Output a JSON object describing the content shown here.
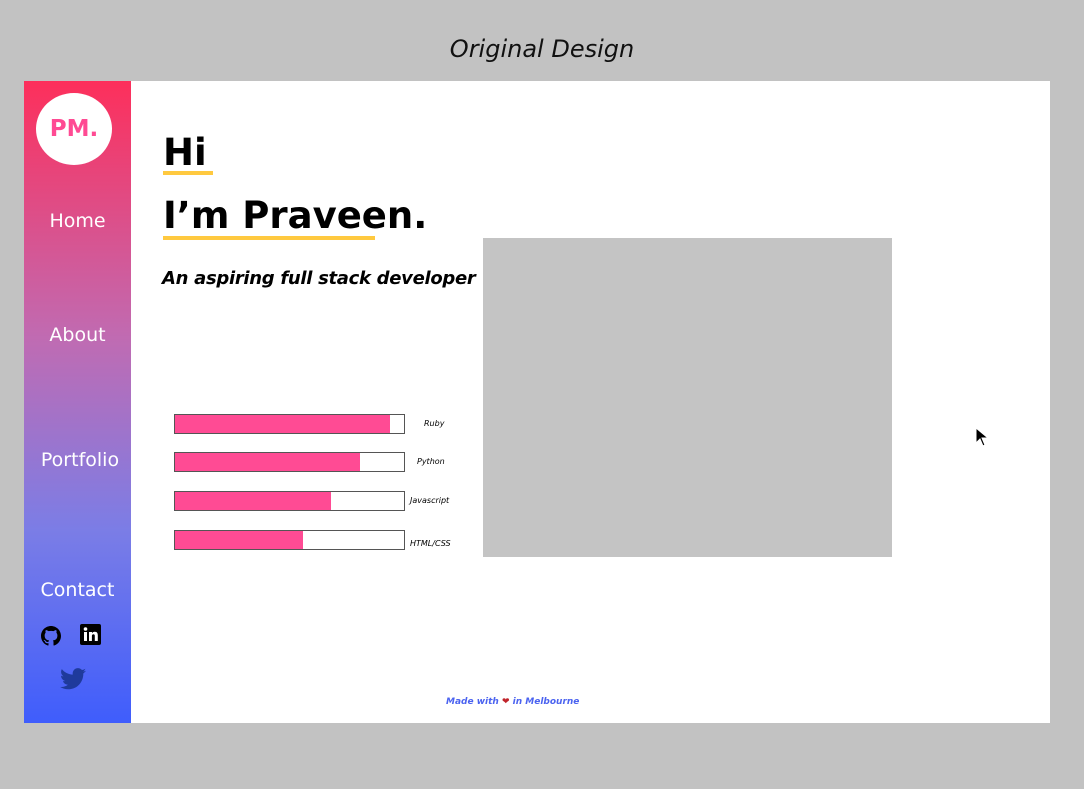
{
  "caption": "Original Design",
  "sidebar": {
    "logo": "PM.",
    "nav": [
      {
        "label": "Home"
      },
      {
        "label": "About"
      },
      {
        "label": "Portfolio"
      },
      {
        "label": "Contact"
      }
    ],
    "social_icons": [
      "github-icon",
      "linkedin-icon",
      "twitter-icon"
    ]
  },
  "hero": {
    "greeting": "Hi",
    "name": "I’m Praveen.",
    "tagline": "An aspiring full stack developer",
    "underline_color": "#ffc93f"
  },
  "skills": [
    {
      "label": "Ruby",
      "level": 0.94
    },
    {
      "label": "Python",
      "level": 0.81
    },
    {
      "label": "Javascript",
      "level": 0.68
    },
    {
      "label": "HTML/CSS",
      "level": 0.56
    }
  ],
  "footer": {
    "prefix": "Made with",
    "heart": "❤",
    "suffix": "in Melbourne"
  },
  "colors": {
    "accent_pink": "#ff4b94",
    "gradient_top": "#fd2f5b",
    "gradient_bottom": "#3f5dfc",
    "footer_blue": "#4b63f0"
  }
}
